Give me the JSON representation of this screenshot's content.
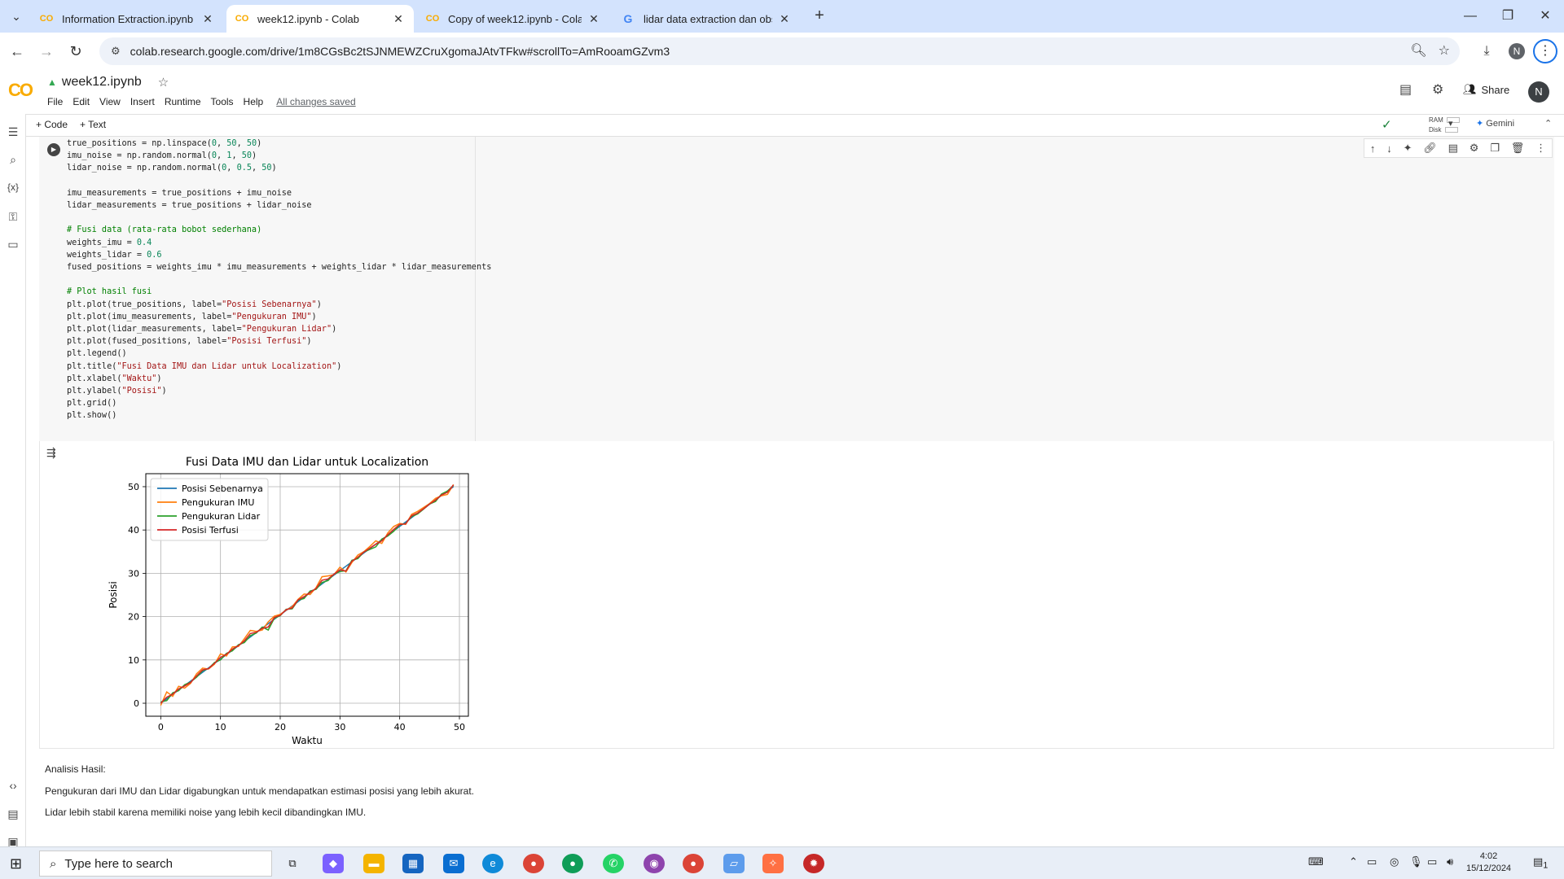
{
  "browser": {
    "tabs": [
      {
        "title": "Information Extraction.ipynb - C",
        "active": false,
        "favicon": "colab-icon"
      },
      {
        "title": "week12.ipynb - Colab",
        "active": true,
        "favicon": "colab-icon"
      },
      {
        "title": "Copy of week12.ipynb - Colab",
        "active": false,
        "favicon": "colab-icon"
      },
      {
        "title": "lidar data extraction dan obstac",
        "active": false,
        "favicon": "google-icon"
      }
    ],
    "url": "colab.research.google.com/drive/1m8CGsBc2tSJNMEWZCruXgomaJAtvTFkw#scrollTo=AmRooamGZvm3",
    "profile_initial": "N"
  },
  "colab": {
    "logo": "CO",
    "notebook_title": "week12.ipynb",
    "menu": [
      "File",
      "Edit",
      "View",
      "Insert",
      "Runtime",
      "Tools",
      "Help"
    ],
    "save_status": "All changes saved",
    "share_label": "Share",
    "user_initial": "N",
    "toolbar": {
      "add_code": "+ Code",
      "add_text": "+ Text",
      "ram_label": "RAM",
      "disk_label": "Disk",
      "gemini_label": "Gemini"
    }
  },
  "code_lines": [
    "true_positions = np.linspace(0, 50, 50)",
    "imu_noise = np.random.normal(0, 1, 50)",
    "lidar_noise = np.random.normal(0, 0.5, 50)",
    "",
    "imu_measurements = true_positions + imu_noise",
    "lidar_measurements = true_positions + lidar_noise",
    "",
    "# Fusi data (rata-rata bobot sederhana)",
    "weights_imu = 0.4",
    "weights_lidar = 0.6",
    "fused_positions = weights_imu * imu_measurements + weights_lidar * lidar_measurements",
    "",
    "# Plot hasil fusi",
    "plt.plot(true_positions, label=\"Posisi Sebenarnya\")",
    "plt.plot(imu_measurements, label=\"Pengukuran IMU\")",
    "plt.plot(lidar_measurements, label=\"Pengukuran Lidar\")",
    "plt.plot(fused_positions, label=\"Posisi Terfusi\")",
    "plt.legend()",
    "plt.title(\"Fusi Data IMU dan Lidar untuk Localization\")",
    "plt.xlabel(\"Waktu\")",
    "plt.ylabel(\"Posisi\")",
    "plt.grid()",
    "plt.show()"
  ],
  "chart_data": {
    "type": "line",
    "title": "Fusi Data IMU dan Lidar untuk Localization",
    "xlabel": "Waktu",
    "ylabel": "Posisi",
    "xlim": [
      -2.5,
      51.5
    ],
    "ylim": [
      -3,
      53
    ],
    "xticks": [
      0,
      10,
      20,
      30,
      40,
      50
    ],
    "yticks": [
      0,
      10,
      20,
      30,
      40,
      50
    ],
    "grid": true,
    "legend_position": "upper-left",
    "x": [
      0,
      1,
      2,
      3,
      4,
      5,
      6,
      7,
      8,
      9,
      10,
      11,
      12,
      13,
      14,
      15,
      16,
      17,
      18,
      19,
      20,
      21,
      22,
      23,
      24,
      25,
      26,
      27,
      28,
      29,
      30,
      31,
      32,
      33,
      34,
      35,
      36,
      37,
      38,
      39,
      40,
      41,
      42,
      43,
      44,
      45,
      46,
      47,
      48,
      49
    ],
    "series": [
      {
        "name": "Posisi Sebenarnya",
        "color": "#1f77b4",
        "values": [
          0,
          1.02,
          2.04,
          3.06,
          4.08,
          5.1,
          6.12,
          7.14,
          8.16,
          9.18,
          10.2,
          11.22,
          12.24,
          13.27,
          14.29,
          15.31,
          16.33,
          17.35,
          18.37,
          19.39,
          20.41,
          21.43,
          22.45,
          23.47,
          24.49,
          25.51,
          26.53,
          27.55,
          28.57,
          29.59,
          30.61,
          31.63,
          32.65,
          33.67,
          34.69,
          35.71,
          36.73,
          37.76,
          38.78,
          39.8,
          40.82,
          41.84,
          42.86,
          43.88,
          44.9,
          45.92,
          46.94,
          47.96,
          48.98,
          50
        ]
      },
      {
        "name": "Pengukuran IMU",
        "color": "#ff7f0e",
        "values": [
          -0.5,
          2.6,
          1.6,
          3.9,
          3.5,
          4.6,
          6.8,
          8.1,
          7.9,
          9.0,
          11.4,
          10.9,
          13.0,
          13.1,
          14.9,
          16.8,
          16.6,
          16.9,
          18.8,
          20.1,
          20.5,
          21.5,
          22.3,
          24.0,
          25.2,
          25.1,
          26.7,
          29.2,
          29.4,
          29.7,
          31.4,
          30.3,
          32.5,
          34.2,
          35.0,
          36.2,
          37.5,
          36.9,
          39.3,
          40.8,
          41.5,
          41.3,
          43.6,
          44.3,
          45.2,
          46.1,
          47.3,
          47.9,
          48.2,
          50.5
        ]
      },
      {
        "name": "Pengukuran Lidar",
        "color": "#2ca02c",
        "values": [
          0.3,
          0.6,
          2.4,
          2.9,
          4.3,
          4.9,
          6.0,
          7.5,
          8.0,
          9.4,
          10.0,
          11.5,
          12.1,
          13.5,
          14.0,
          15.6,
          16.2,
          17.6,
          16.9,
          19.6,
          20.2,
          21.7,
          21.8,
          23.8,
          24.2,
          25.9,
          26.3,
          27.9,
          28.3,
          29.8,
          30.4,
          30.6,
          33.0,
          33.4,
          34.9,
          35.5,
          36.1,
          37.9,
          38.6,
          39.7,
          41.2,
          41.5,
          43.1,
          43.7,
          44.8,
          46.0,
          46.6,
          48.3,
          49.0,
          50.3
        ]
      },
      {
        "name": "Posisi Terfusi",
        "color": "#d62728",
        "values": [
          0.0,
          1.4,
          2.1,
          3.3,
          4.0,
          4.8,
          6.3,
          7.7,
          8.0,
          9.2,
          10.6,
          11.3,
          12.5,
          13.3,
          14.4,
          16.1,
          16.4,
          17.3,
          17.6,
          19.8,
          20.3,
          21.6,
          22.0,
          23.9,
          24.6,
          25.6,
          26.5,
          28.4,
          28.7,
          29.8,
          30.8,
          30.5,
          32.8,
          33.7,
          34.9,
          35.8,
          36.7,
          37.5,
          38.9,
          40.1,
          41.3,
          41.4,
          43.3,
          43.9,
          44.9,
          46.0,
          46.9,
          48.1,
          48.7,
          50.4
        ]
      }
    ]
  },
  "markdown": {
    "heading": "Analisis Hasil:",
    "line1": "Pengukuran dari IMU dan Lidar digabungkan untuk mendapatkan estimasi posisi yang lebih akurat.",
    "line2": "Lidar lebih stabil karena memiliki noise yang lebih kecil dibandingkan IMU."
  },
  "taskbar": {
    "search_placeholder": "Type here to search",
    "time": "4:02",
    "date": "15/12/2024",
    "notification_count": "1"
  }
}
